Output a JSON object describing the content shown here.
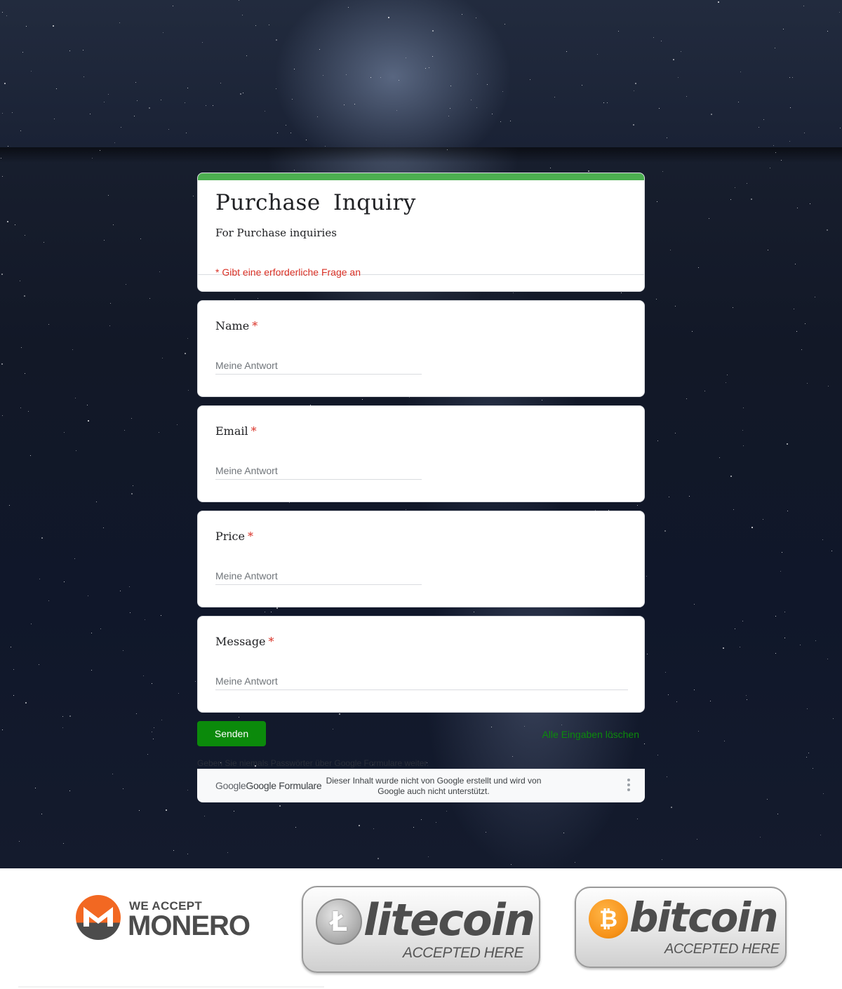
{
  "form": {
    "title": "Purchase Inquiry",
    "description": "For Purchase inquiries",
    "required_note": "* Gibt eine erforderliche Frage an",
    "accent_color": "#4caf50",
    "questions": [
      {
        "label": "Name",
        "required_mark": "*",
        "placeholder": "Meine Antwort"
      },
      {
        "label": "Email",
        "required_mark": "*",
        "placeholder": "Meine Antwort"
      },
      {
        "label": "Price",
        "required_mark": "*",
        "placeholder": "Meine Antwort"
      },
      {
        "label": "Message",
        "required_mark": "*",
        "placeholder": "Meine Antwort"
      }
    ],
    "submit_label": "Senden",
    "clear_label": "Alle Eingaben löschen",
    "password_note": "Geben Sie niemals Passwörter über Google Formulare weiter.",
    "footer": {
      "logo_text_google": "Google",
      "logo_text_forms": "Google Formulare",
      "disclaimer": "Dieser Inhalt wurde nicht von Google erstellt und wird von Google auch nicht unterstützt."
    },
    "button_color": "#0b8a0b",
    "required_color": "#d93025"
  },
  "badges": {
    "monero": {
      "line1": "WE ACCEPT",
      "line2": "MONERO",
      "color": "#f26822"
    },
    "litecoin": {
      "word": "litecoin",
      "sub": "ACCEPTED HERE",
      "glyph": "Ł"
    },
    "bitcoin": {
      "word": "bitcoin",
      "sub": "ACCEPTED HERE",
      "glyph": "₿",
      "color": "#f7931a"
    }
  }
}
